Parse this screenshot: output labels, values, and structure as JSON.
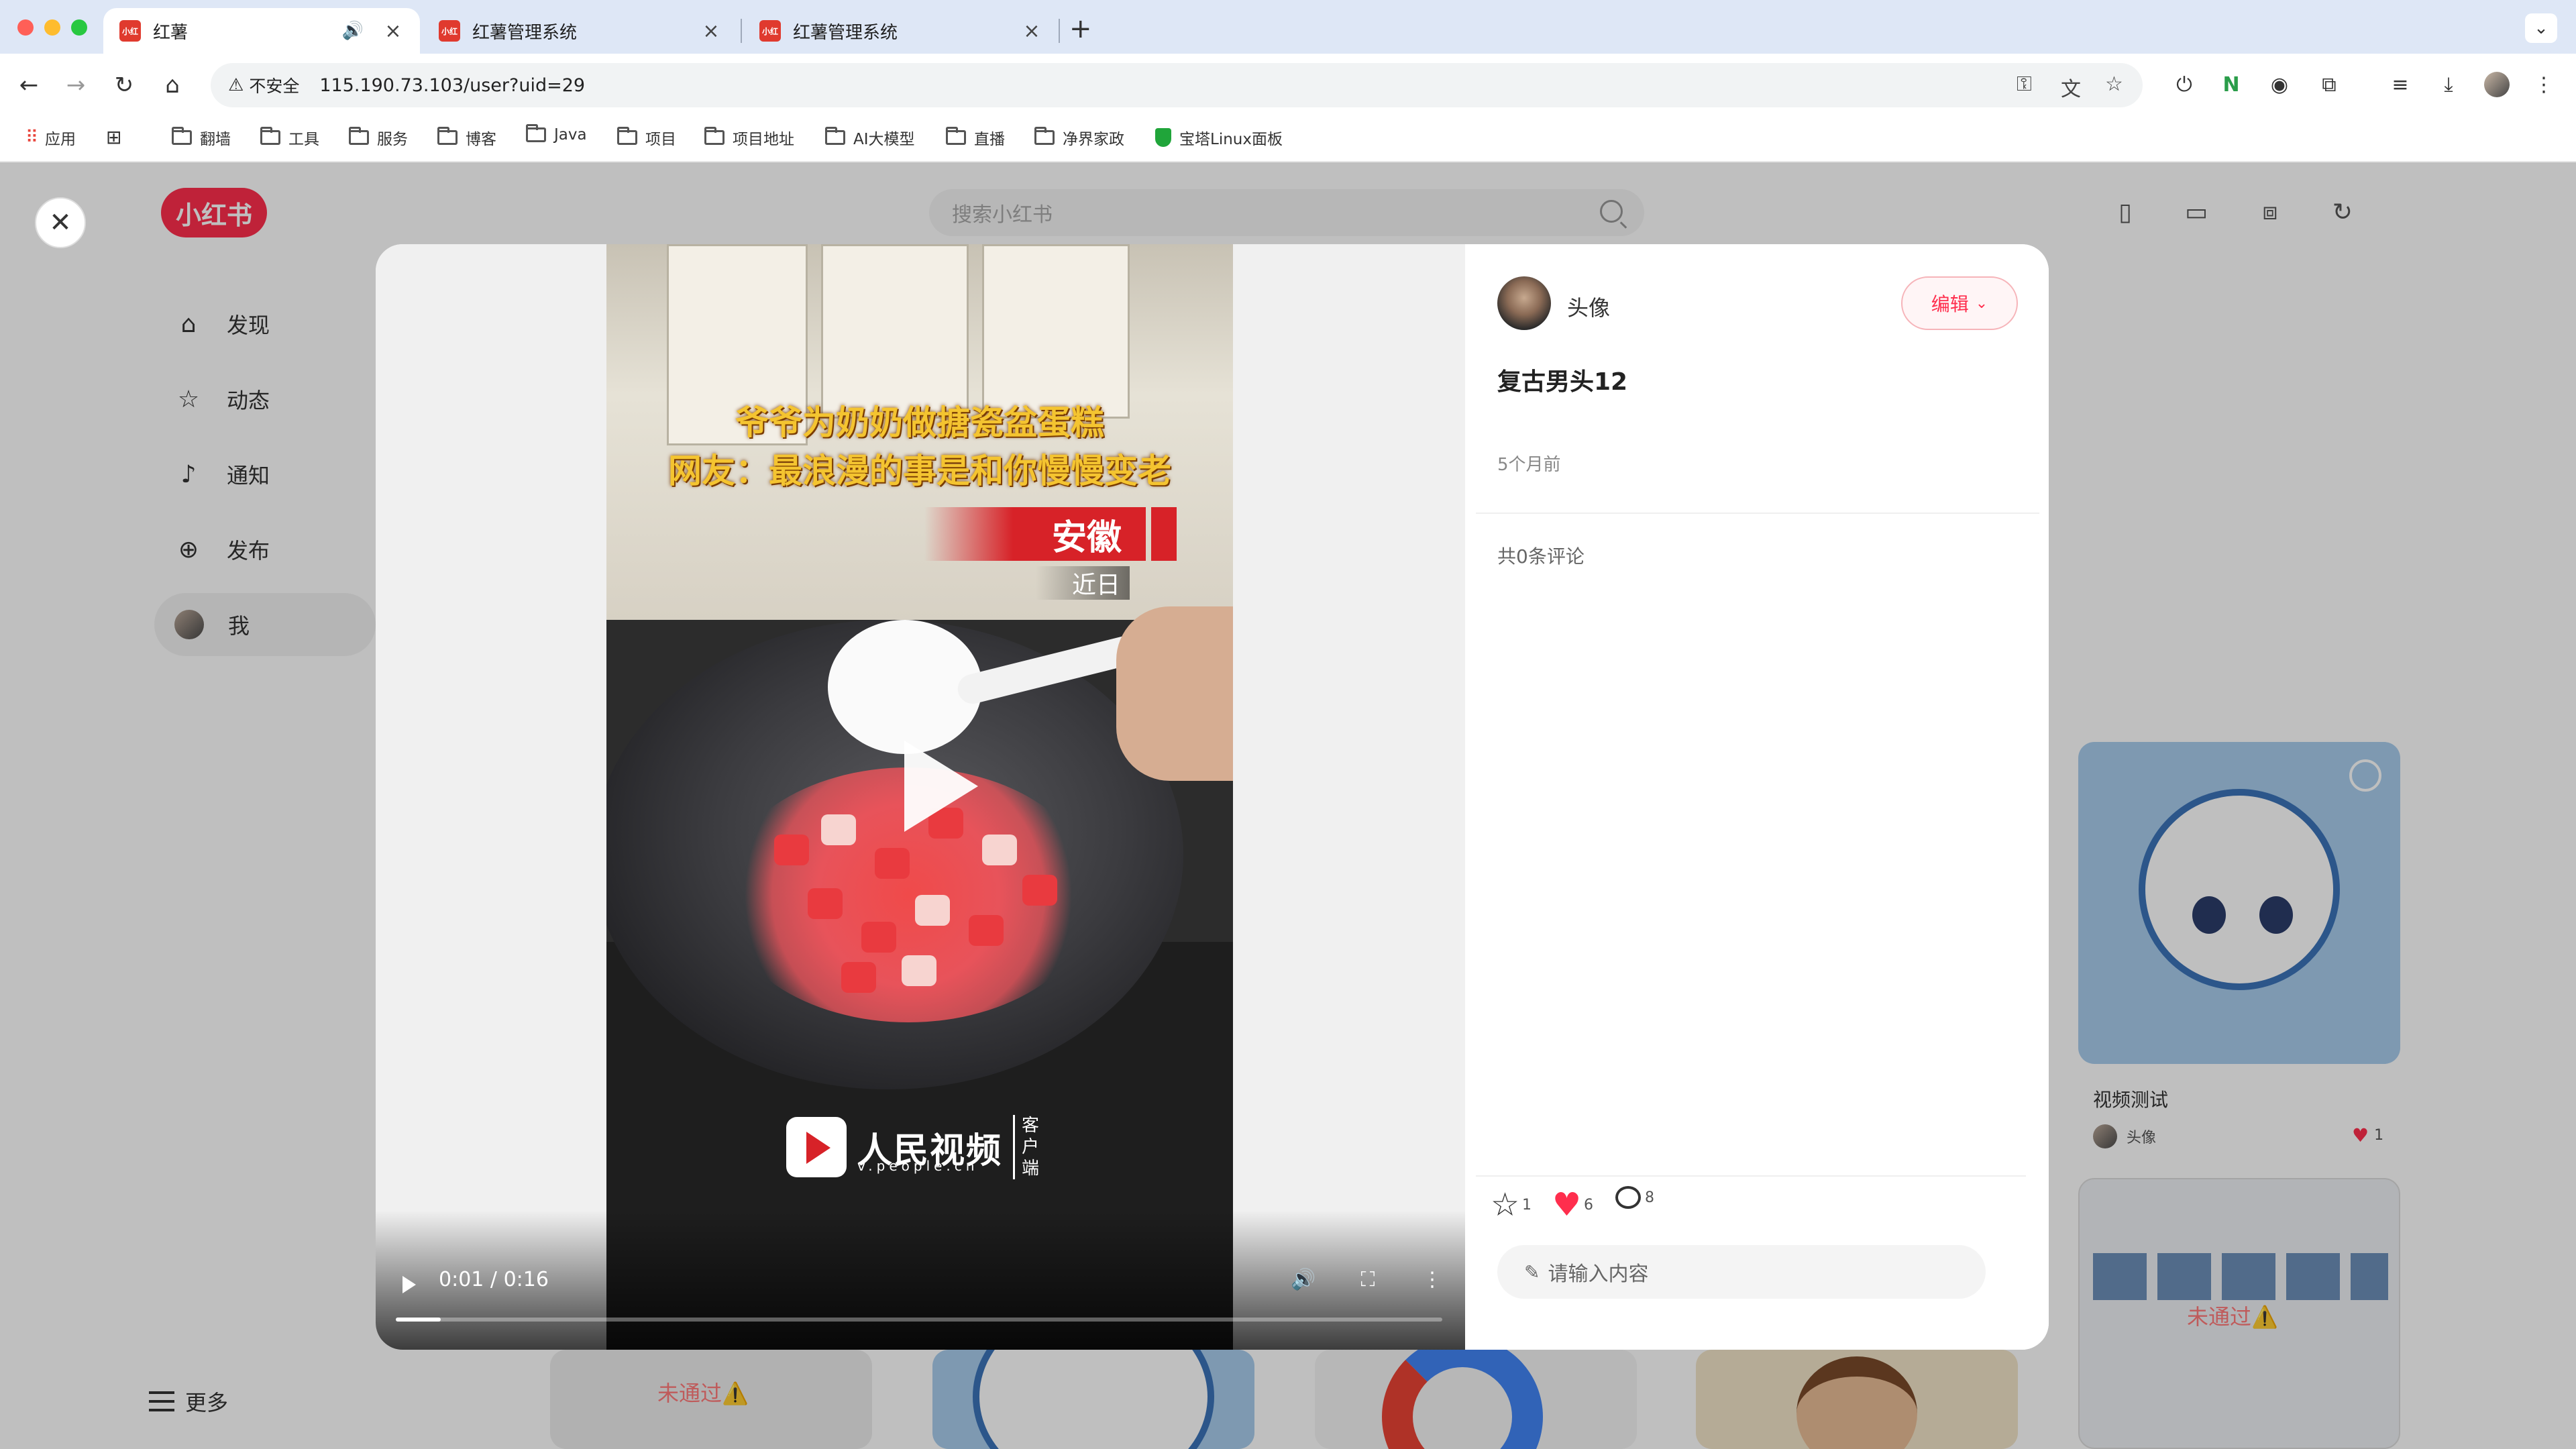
{
  "browser": {
    "tabs": [
      {
        "title": "红薯",
        "active": true,
        "audio": true
      },
      {
        "title": "红薯管理系统",
        "active": false
      },
      {
        "title": "红薯管理系统",
        "active": false
      }
    ],
    "security_label": "不安全",
    "url": "115.190.73.103/user?uid=29",
    "bookmarks": [
      "应用",
      "翻墙",
      "工具",
      "服务",
      "博客",
      "Java",
      "项目",
      "项目地址",
      "AI大模型",
      "直播",
      "净界家政",
      "宝塔Linux面板"
    ]
  },
  "app": {
    "logo": "小红书",
    "search_placeholder": "搜索小红书",
    "sidebar": [
      {
        "label": "发现",
        "icon": "home-icon"
      },
      {
        "label": "动态",
        "icon": "star-icon"
      },
      {
        "label": "通知",
        "icon": "bell-icon"
      },
      {
        "label": "发布",
        "icon": "plus-circle-icon"
      },
      {
        "label": "我",
        "icon": "avatar",
        "active": true
      }
    ],
    "more_label": "更多",
    "feed": {
      "card1_title": "视频测试",
      "card1_author": "头像",
      "card1_likes": "1",
      "card2_overlay": "未通过⚠️",
      "bottom_overlay": "未通过⚠️"
    }
  },
  "modal": {
    "video": {
      "caption_line1": "爷爷为奶奶做搪瓷盆蛋糕",
      "caption_line2": "网友：最浪漫的事是和你慢慢变老",
      "location": "安徽",
      "date": "近日",
      "watermark": "人民视频",
      "watermark_sub": "v.people.cn",
      "watermark_client": "客户端",
      "time_current": "0:01",
      "time_total": "0:16",
      "time_sep": " / ",
      "progress": 0.043
    },
    "author_name": "头像",
    "edit_label": "编辑",
    "title": "复古男头12",
    "time_ago": "5个月前",
    "comments_count": "共0条评论",
    "actions": {
      "collect": "1",
      "like": "6",
      "comment": "8"
    },
    "comment_placeholder": "请输入内容"
  },
  "colors": {
    "brand": "#ff2e4d",
    "tabbar": "#dee7f6"
  }
}
